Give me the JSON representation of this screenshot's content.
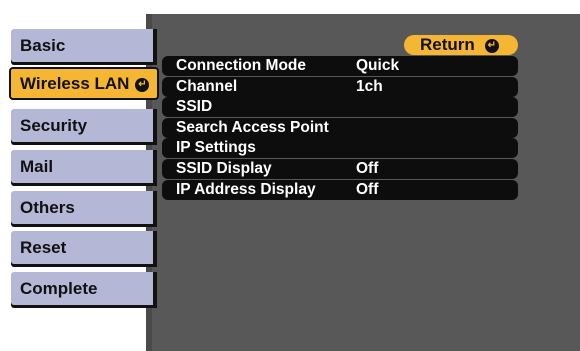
{
  "sidebar": {
    "items": [
      {
        "label": "Basic"
      },
      {
        "label": "Wireless LAN",
        "active": true
      },
      {
        "label": "Security"
      },
      {
        "label": "Mail"
      },
      {
        "label": "Others"
      },
      {
        "label": "Reset"
      },
      {
        "label": "Complete"
      }
    ],
    "return_glyph": "↵"
  },
  "panel": {
    "return_label": "Return",
    "rows": [
      {
        "label": "Connection Mode",
        "value": "Quick"
      },
      {
        "label": "Channel",
        "value": "1ch"
      },
      {
        "label": "SSID",
        "value": ""
      },
      {
        "label": "Search Access Point",
        "value": ""
      },
      {
        "label": "IP Settings",
        "value": ""
      },
      {
        "label": "SSID Display",
        "value": "Off"
      },
      {
        "label": "IP Address Display",
        "value": "Off"
      }
    ]
  },
  "colors": {
    "accent": "#f5b733",
    "sidebar_item": "#b5b7d6",
    "panel_bg": "#585858",
    "row_bg": "#0d0d0d"
  }
}
